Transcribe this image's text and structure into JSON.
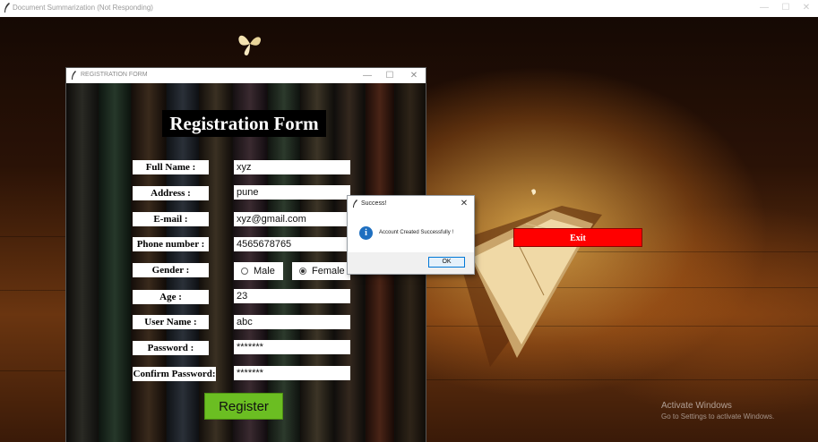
{
  "window": {
    "title": "Document Summarization  (Not Responding)",
    "minimize_glyph": "—",
    "maximize_glyph": "☐",
    "close_glyph": "✕"
  },
  "registration_window": {
    "title": "REGISTRATION FORM",
    "minimize_glyph": "—",
    "maximize_glyph": "☐",
    "close_glyph": "✕",
    "form_title": "Registration Form",
    "fields": {
      "full_name": {
        "label": "Full Name :",
        "value": "xyz"
      },
      "address": {
        "label": "Address :",
        "value": "pune"
      },
      "email": {
        "label": "E-mail :",
        "value": "xyz@gmail.com"
      },
      "phone": {
        "label": "Phone number :",
        "value": "4565678765"
      },
      "gender": {
        "label": "Gender :",
        "options": [
          "Male",
          "Female"
        ],
        "selected": "Female"
      },
      "age": {
        "label": "Age :",
        "value": "23"
      },
      "username": {
        "label": "User Name :",
        "value": "abc"
      },
      "password": {
        "label": "Password :",
        "value": "*******"
      },
      "confirm_password": {
        "label": "Confirm Password:",
        "value": "*******"
      }
    },
    "register_label": "Register"
  },
  "exit_label": "Exit",
  "dialog": {
    "title": "Success!",
    "close_glyph": "✕",
    "icon": "info-icon",
    "icon_glyph": "i",
    "message": "Account Created Successfully !",
    "ok_label": "OK"
  },
  "watermark": {
    "line1": "Activate Windows",
    "line2": "Go to Settings to activate Windows."
  },
  "colors": {
    "exit_button": "#ff0000",
    "register_button": "#6bbe22",
    "info_icon": "#1e6fc0",
    "form_title_bg": "#000000"
  }
}
